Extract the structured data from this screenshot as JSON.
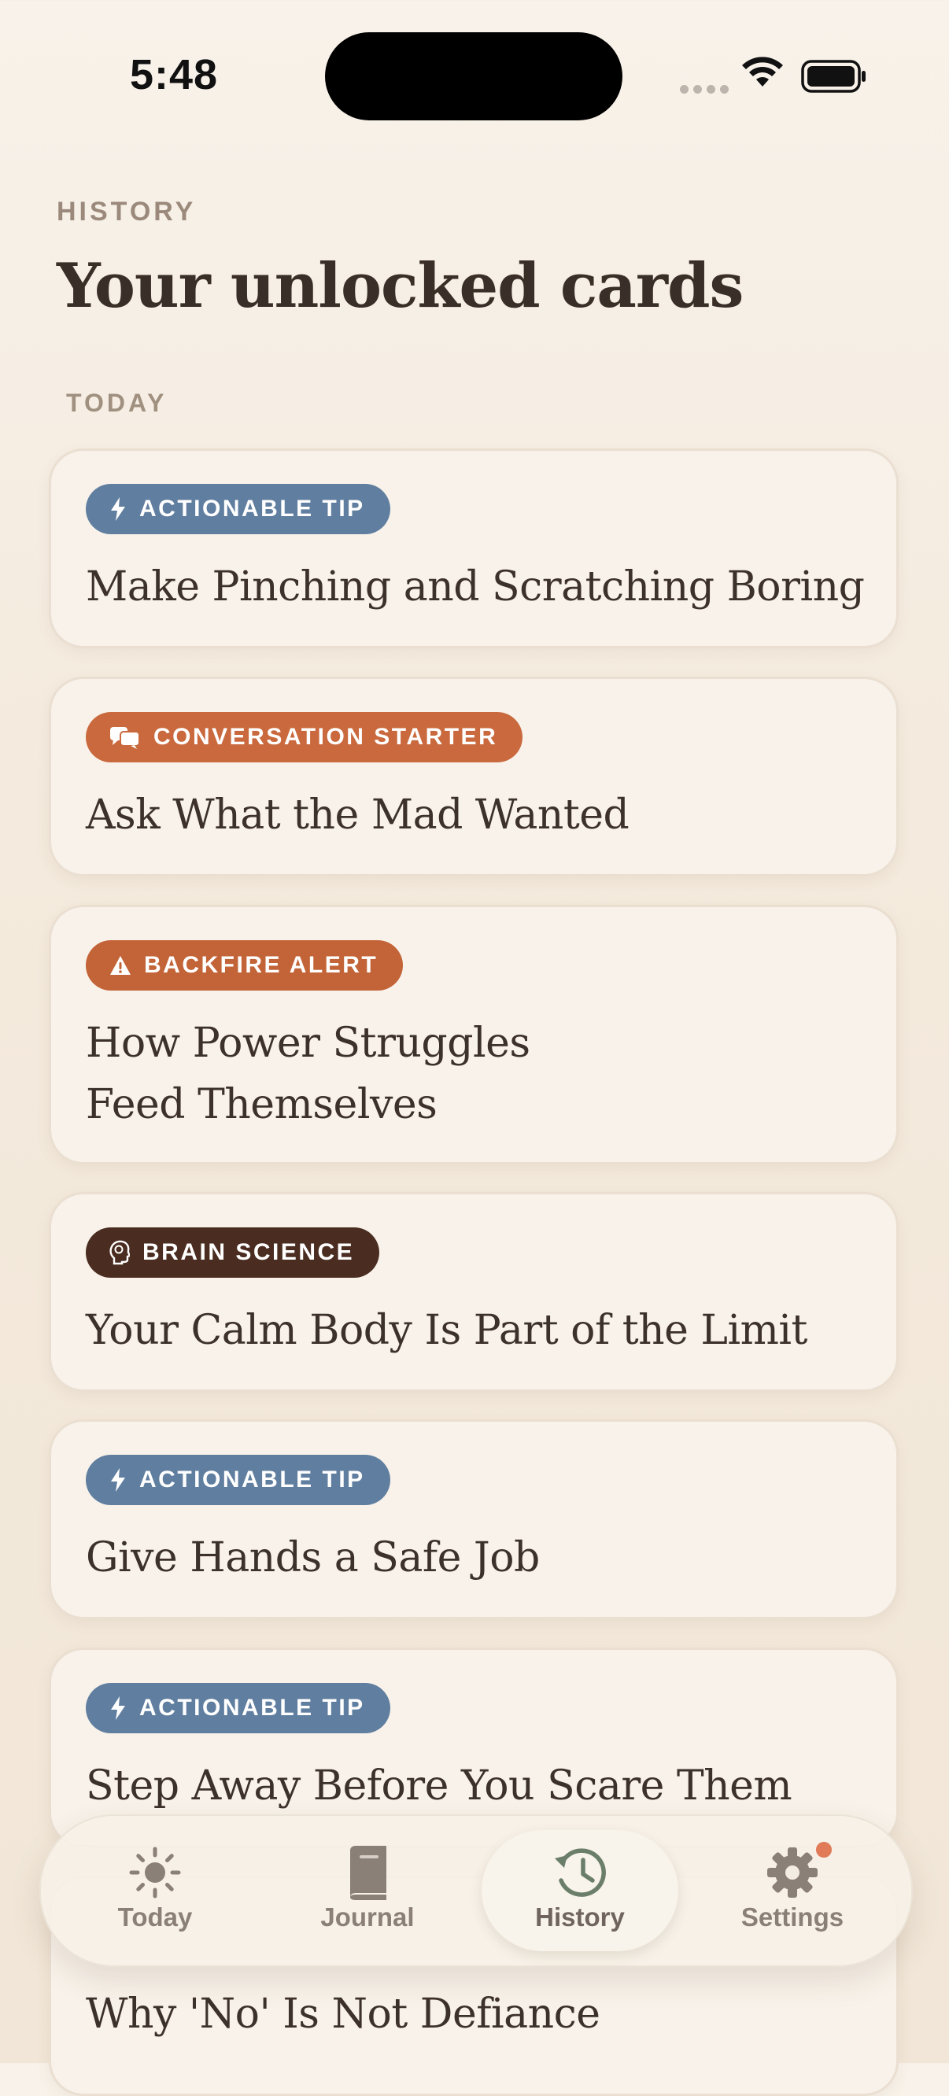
{
  "status_bar": {
    "time": "5:48"
  },
  "header": {
    "eyebrow": "HISTORY",
    "title": "Your unlocked cards"
  },
  "section": {
    "label": "TODAY"
  },
  "colors": {
    "actionable_tip": "#607e9f",
    "conversation_starter": "#c9693d",
    "backfire_alert": "#c36438",
    "brain_science": "#4a2c20",
    "settings_badge": "#e07a57"
  },
  "cards": [
    {
      "tag": "ACTIONABLE TIP",
      "icon": "bolt-icon",
      "title": "Make Pinching and Scratching Boring"
    },
    {
      "tag": "CONVERSATION STARTER",
      "icon": "chat-bubbles-icon",
      "title": "Ask What the Mad Wanted"
    },
    {
      "tag": "BACKFIRE ALERT",
      "icon": "warning-icon",
      "title_line1": "How Power Struggles",
      "title_line2": "Feed Themselves"
    },
    {
      "tag": "BRAIN SCIENCE",
      "icon": "brain-head-icon",
      "title": "Your Calm Body Is Part of the Limit"
    },
    {
      "tag": "ACTIONABLE TIP",
      "icon": "bolt-icon",
      "title": "Give Hands a Safe Job"
    },
    {
      "tag": "ACTIONABLE TIP",
      "icon": "bolt-icon",
      "title": "Step Away Before You Scare Them"
    },
    {
      "title": "Why 'No' Is Not Defiance"
    }
  ],
  "nav": {
    "items": [
      {
        "label": "Today",
        "icon": "sun-icon"
      },
      {
        "label": "Journal",
        "icon": "book-icon"
      },
      {
        "label": "History",
        "icon": "history-clock-icon",
        "active": true
      },
      {
        "label": "Settings",
        "icon": "gear-icon",
        "has_badge": true
      }
    ]
  }
}
